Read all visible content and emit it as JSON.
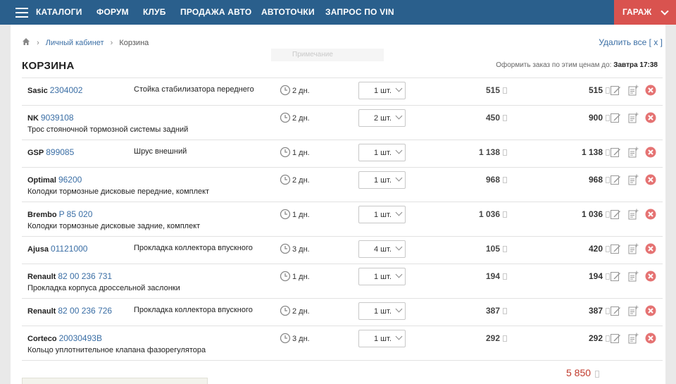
{
  "nav": {
    "items": [
      "КАТАЛОГИ",
      "ФОРУМ",
      "КЛУБ",
      "ПРОДАЖА АВТО",
      "АВТОТОЧКИ",
      "ЗАПРОС ПО VIN"
    ],
    "garage": "ГАРАЖ",
    "accent": "#2a5f8c",
    "garage_color": "#d9534f"
  },
  "breadcrumb": {
    "parent": "Личный кабинет",
    "current": "Корзина"
  },
  "clear_all": "Удалить все [ x ]",
  "ghost_hint": "Примечание",
  "cart": {
    "title": "КОРЗИНА",
    "deadline_label": "Оформить заказ по этим ценам до:",
    "deadline_value": "Завтра 17:38",
    "total": "5 850"
  },
  "items": [
    {
      "brand": "Sasic",
      "code": "2304002",
      "desc": "Стойка стабилизатора переднего",
      "days": "2 дн.",
      "qty": "1 шт.",
      "price": "515",
      "total": "515"
    },
    {
      "brand": "NK",
      "code": "9039108",
      "desc": "Трос стояночной тормозной системы задний",
      "days": "2 дн.",
      "qty": "2 шт.",
      "price": "450",
      "total": "900"
    },
    {
      "brand": "GSP",
      "code": "899085",
      "desc": "Шрус внешний",
      "days": "1 дн.",
      "qty": "1 шт.",
      "price": "1 138",
      "total": "1 138"
    },
    {
      "brand": "Optimal",
      "code": "96200",
      "desc": "Колодки тормозные дисковые передние, комплект",
      "days": "2 дн.",
      "qty": "1 шт.",
      "price": "968",
      "total": "968"
    },
    {
      "brand": "Brembo",
      "code": "P 85 020",
      "desc": "Колодки тормозные дисковые задние, комплект",
      "days": "1 дн.",
      "qty": "1 шт.",
      "price": "1 036",
      "total": "1 036"
    },
    {
      "brand": "Ajusa",
      "code": "01121000",
      "desc": "Прокладка коллектора впускного",
      "days": "3 дн.",
      "qty": "4 шт.",
      "price": "105",
      "total": "420"
    },
    {
      "brand": "Renault",
      "code": "82 00 236 731",
      "desc": "Прокладка корпуса дроссельной заслонки",
      "days": "1 дн.",
      "qty": "1 шт.",
      "price": "194",
      "total": "194"
    },
    {
      "brand": "Renault",
      "code": "82 00 236 726",
      "desc": "Прокладка коллектора впускного",
      "days": "2 дн.",
      "qty": "1 шт.",
      "price": "387",
      "total": "387"
    },
    {
      "brand": "Corteco",
      "code": "20030493B",
      "desc": "Кольцо уплотнительное клапана фазорегулятора",
      "days": "3 дн.",
      "qty": "1 шт.",
      "price": "292",
      "total": "292"
    }
  ]
}
